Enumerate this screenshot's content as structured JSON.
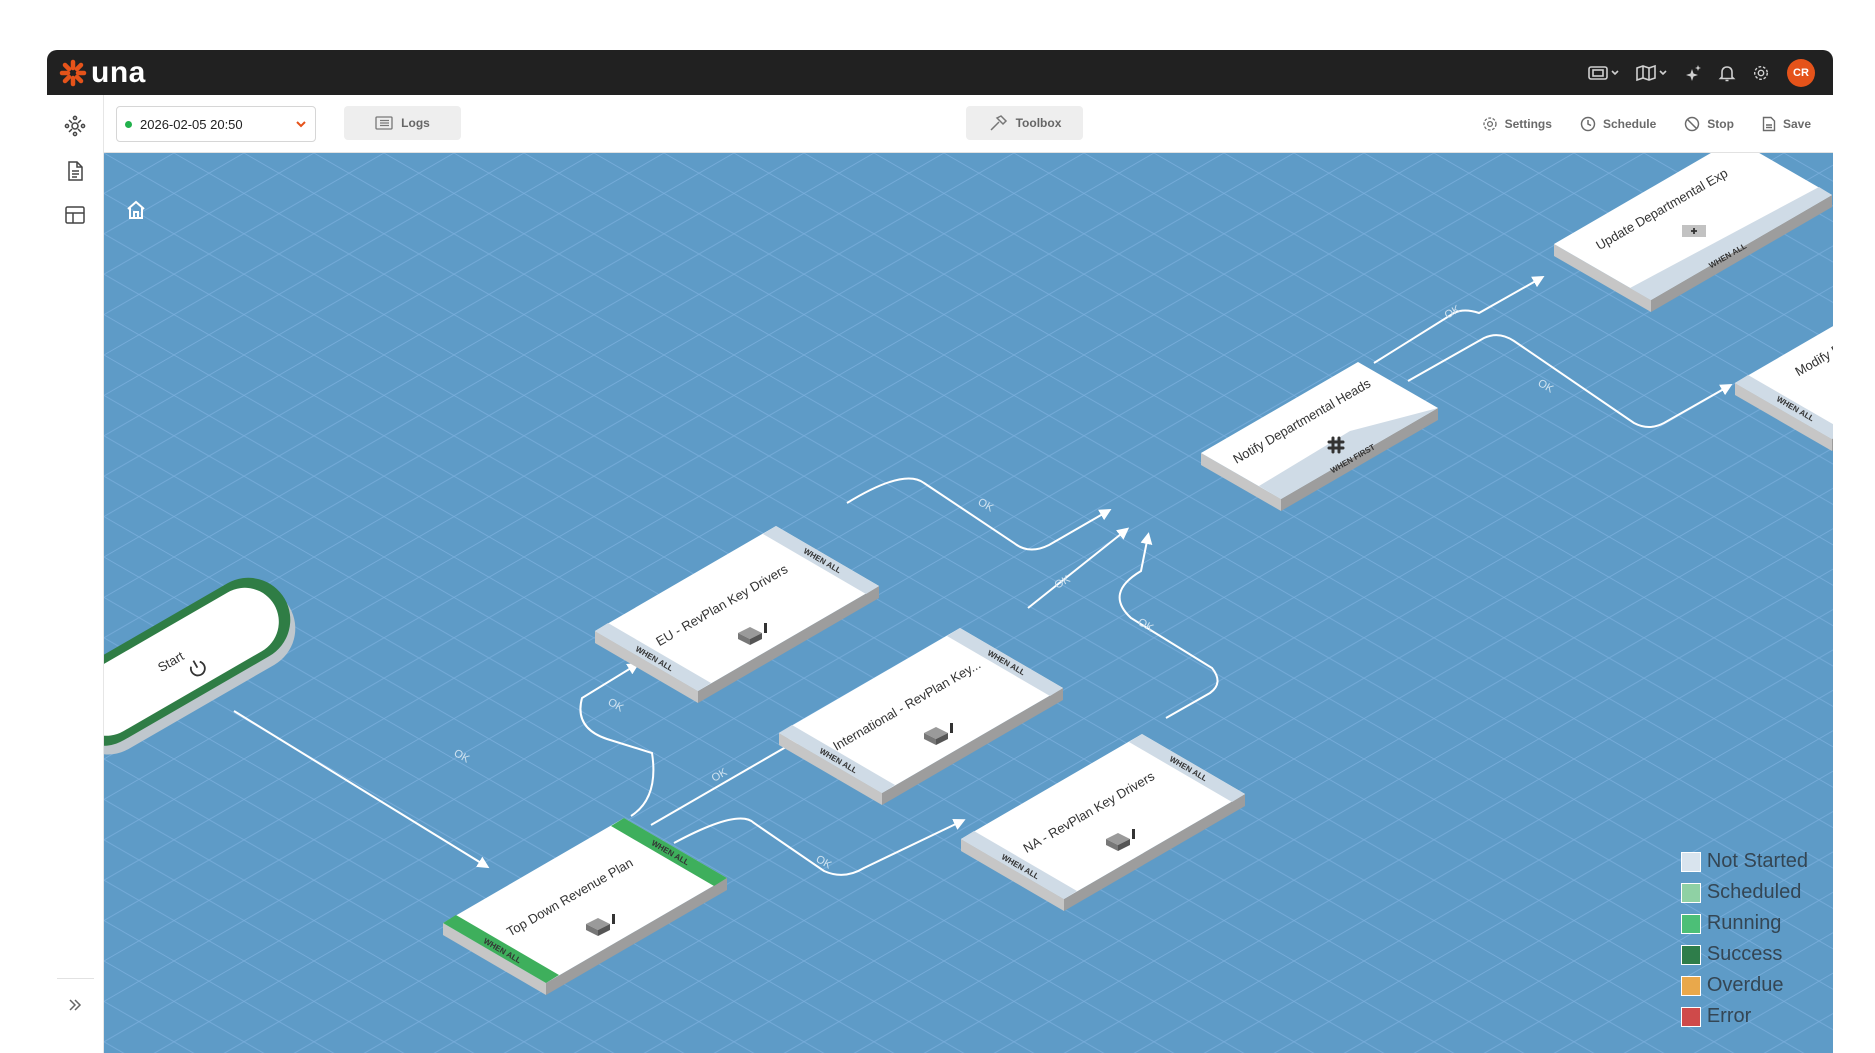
{
  "app": {
    "brand": "una",
    "avatar_initials": "CR",
    "accent": "#e5531a"
  },
  "topbar": {
    "icons": [
      "display-icon",
      "map-icon",
      "sparkle-icon",
      "bell-icon",
      "gear-icon"
    ]
  },
  "sidebar": {
    "icons": [
      "workflow-icon",
      "document-icon",
      "layout-icon"
    ],
    "expand_icon": "double-chevron-right-icon"
  },
  "toolbar": {
    "run_select": {
      "value": "2026-02-05 20:50",
      "status_color": "#22b14c"
    },
    "logs_label": "Logs",
    "toolbox_label": "Toolbox",
    "settings_label": "Settings",
    "schedule_label": "Schedule",
    "stop_label": "Stop",
    "save_label": "Save"
  },
  "nodes": [
    {
      "id": "start",
      "label": "Start",
      "status": "Success"
    },
    {
      "id": "top-down",
      "label": "Top Down Revenue Plan",
      "top_tag": "WHEN ALL",
      "bottom_tag": "WHEN ALL",
      "status": "Success"
    },
    {
      "id": "eu",
      "label": "EU - RevPlan Key Drivers",
      "top_tag": "WHEN ALL",
      "bottom_tag": "WHEN ALL",
      "status": "Not Started"
    },
    {
      "id": "intl",
      "label": "International - RevPlan Key...",
      "top_tag": "WHEN ALL",
      "bottom_tag": "WHEN ALL",
      "status": "Not Started"
    },
    {
      "id": "na",
      "label": "NA - RevPlan Key Drivers",
      "top_tag": "WHEN ALL",
      "bottom_tag": "WHEN ALL",
      "status": "Not Started"
    },
    {
      "id": "notify",
      "label": "Notify Departmental Heads",
      "bottom_tag": "WHEN FIRST",
      "status": "Not Started"
    },
    {
      "id": "update",
      "label": "Update Departmental Exp",
      "bottom_tag": "WHEN ALL",
      "status": "Not Started"
    },
    {
      "id": "modify",
      "label": "Modify Revenue",
      "bottom_tag": "WHEN ALL",
      "status": "Not Started"
    }
  ],
  "edge_label": "OK",
  "legend": [
    {
      "label": "Not Started",
      "color": "#d9e4ee"
    },
    {
      "label": "Scheduled",
      "color": "#8fd1a4"
    },
    {
      "label": "Running",
      "color": "#4cbf77"
    },
    {
      "label": "Success",
      "color": "#2e7d4a"
    },
    {
      "label": "Overdue",
      "color": "#e9a84b"
    },
    {
      "label": "Error",
      "color": "#cf4a4a"
    }
  ]
}
